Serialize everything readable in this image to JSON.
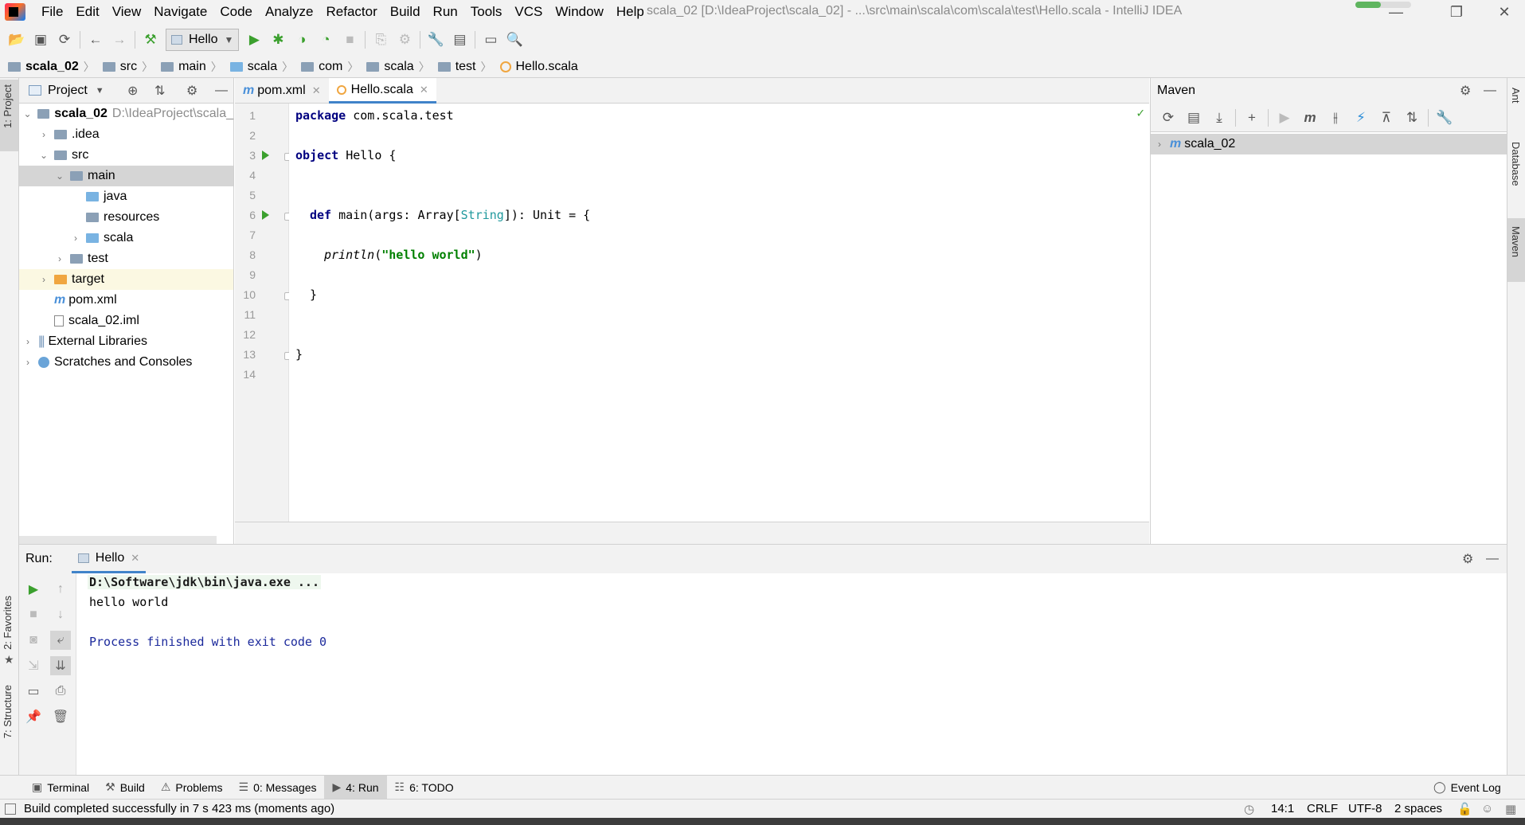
{
  "window": {
    "title": "scala_02 [D:\\IdeaProject\\scala_02] - ...\\src\\main\\scala\\com\\scala\\test\\Hello.scala - IntelliJ IDEA",
    "minimize": "—",
    "restore": "❐",
    "close": "✕"
  },
  "menu": [
    "File",
    "Edit",
    "View",
    "Navigate",
    "Code",
    "Analyze",
    "Refactor",
    "Build",
    "Run",
    "Tools",
    "VCS",
    "Window",
    "Help"
  ],
  "toolbar": {
    "run_config": "Hello"
  },
  "breadcrumb": [
    "scala_02",
    "src",
    "main",
    "scala",
    "com",
    "scala",
    "test",
    "Hello.scala"
  ],
  "left_stripe": {
    "project": "1: Project",
    "favorites": "2: Favorites",
    "structure": "7: Structure"
  },
  "project": {
    "title": "Project",
    "tree": [
      {
        "label": "scala_02",
        "extra": "D:\\IdeaProject\\scala_"
      },
      {
        "label": ".idea"
      },
      {
        "label": "src"
      },
      {
        "label": "main"
      },
      {
        "label": "java"
      },
      {
        "label": "resources"
      },
      {
        "label": "scala"
      },
      {
        "label": "test"
      },
      {
        "label": "target"
      },
      {
        "label": "pom.xml"
      },
      {
        "label": "scala_02.iml"
      },
      {
        "label": "External Libraries"
      },
      {
        "label": "Scratches and Consoles"
      }
    ]
  },
  "editor": {
    "tabs": [
      {
        "label": "pom.xml"
      },
      {
        "label": "Hello.scala"
      }
    ],
    "line_numbers": [
      "1",
      "2",
      "3",
      "4",
      "5",
      "6",
      "7",
      "8",
      "9",
      "10",
      "11",
      "12",
      "13",
      "14"
    ],
    "code": {
      "l1_kw": "package",
      "l1_rest": " com.scala.test",
      "l3_kw": "object",
      "l3_rest": " Hello {",
      "l6_kw": "def",
      "l6_a": " main(args: Array[",
      "l6_type": "String",
      "l6_b": "]): Unit = {",
      "l8_fn": "println",
      "l8_open": "(",
      "l8_str": "\"hello world\"",
      "l8_close": ")",
      "l10": "}",
      "l13": "}"
    }
  },
  "maven": {
    "title": "Maven",
    "project": "scala_02"
  },
  "right_stripe": {
    "ant": "Ant",
    "database": "Database",
    "maven": "Maven"
  },
  "run": {
    "label": "Run:",
    "tab": "Hello",
    "output": {
      "cmd": "D:\\Software\\jdk\\bin\\java.exe ...",
      "line1": "hello world",
      "finish": "Process finished with exit code 0"
    }
  },
  "bottom_tabs": [
    {
      "label": "Terminal"
    },
    {
      "label": "Build"
    },
    {
      "label": "Problems"
    },
    {
      "label": "0: Messages"
    },
    {
      "label": "4: Run"
    },
    {
      "label": "6: TODO"
    }
  ],
  "event_log": "Event Log",
  "status": {
    "message": "Build completed successfully in 7 s 423 ms (moments ago)",
    "position": "14:1",
    "line_sep": "CRLF",
    "encoding": "UTF-8",
    "indent": "2 spaces"
  },
  "colors": {
    "keyword": "#000080",
    "string": "#008000",
    "type": "#20999d",
    "run_icon": "#3ba02e",
    "accent": "#4083c9"
  }
}
